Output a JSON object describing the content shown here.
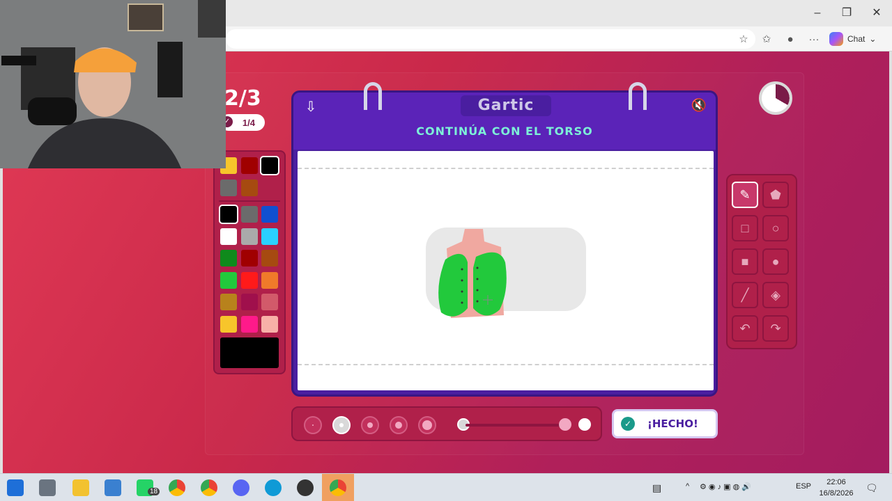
{
  "browser": {
    "chat_label": "Chat",
    "window_controls": [
      "minimize-icon",
      "restore-icon",
      "close-icon"
    ],
    "toolbar_icons": [
      "star-icon",
      "favorites-icon",
      "profile-icon",
      "more-icon"
    ]
  },
  "game": {
    "round": "2/3",
    "turn": "1/4",
    "logo": "Gartic",
    "instruction": "CONTINÚA CON EL TORSO",
    "done_label": "¡HECHO!",
    "palette": {
      "recent": [
        "#f7c52b",
        "#a00000",
        "#000000",
        "#6b6b6b",
        "#a64a10"
      ],
      "colors": [
        "#000000",
        "#6b6b6b",
        "#1050d0",
        "#ffffff",
        "#aaaaaa",
        "#2ad0ff",
        "#0f8a1c",
        "#a00000",
        "#a64a10",
        "#22c93c",
        "#ff1a1a",
        "#f07a2a",
        "#b8821c",
        "#a0104c",
        "#d25a6a",
        "#f7c52b",
        "#ff1a8a",
        "#f8b0a8"
      ],
      "current": "#000000"
    },
    "tools": [
      "pencil-icon",
      "eraser-icon",
      "rectangle-outline-icon",
      "circle-outline-icon",
      "rectangle-filled-icon",
      "circle-filled-icon",
      "line-icon",
      "fill-bucket-icon",
      "undo-icon",
      "redo-icon"
    ],
    "brush_sizes": 5,
    "selected_brush": 2,
    "opacity_level": 1.0
  },
  "taskbar": {
    "whatsapp_badge": "18",
    "lang": "ESP",
    "time": "22:06",
    "date": "16/8/2026"
  }
}
